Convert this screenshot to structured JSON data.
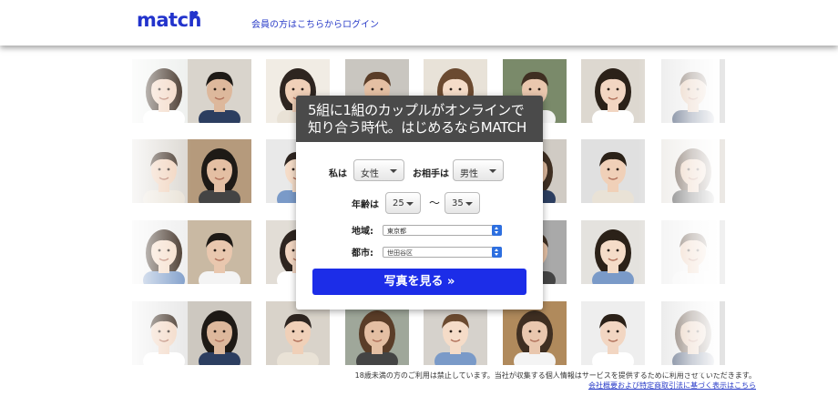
{
  "header": {
    "logo_text": "match",
    "login_link": "会員の方はこちらからログイン"
  },
  "panel": {
    "headline_line1": "5組に1組のカップルがオンラインで",
    "headline_line2": "知り合う時代。はじめるならMATCH",
    "me_label": "私は",
    "me_value": "女性",
    "partner_label": "お相手は",
    "partner_value": "男性",
    "age_label": "年齢は",
    "age_min": "25",
    "age_separator": "〜",
    "age_max": "35",
    "region_label": "地域:",
    "region_value": "東京都",
    "city_label": "都市:",
    "city_value": "世田谷区",
    "submit_label": "写真を見る »"
  },
  "footer": {
    "notice": "18歳未満の方のご利用は禁止しています。当社が収集する個人情報はサービスを提供するために利用させていただきます。",
    "link": "会社概要および特定商取引法に基づく表示はこちら"
  },
  "colors": {
    "brand_blue": "#2233cc",
    "cta_blue": "#1c2de8",
    "panel_header": "#4a4a4a"
  }
}
